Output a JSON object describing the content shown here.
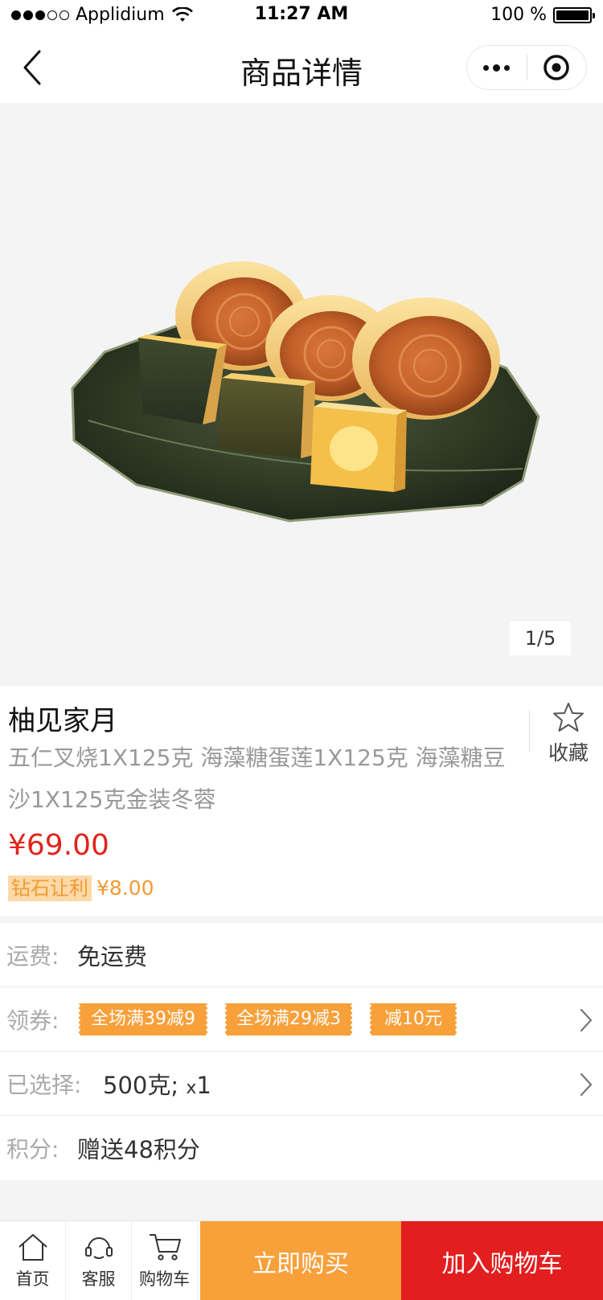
{
  "status_bar": {
    "carrier": "Applidium",
    "time": "11:27 AM",
    "battery": "100 %",
    "signal_bars_filled": 3,
    "signal_bars_total": 5
  },
  "nav": {
    "title": "商品详情",
    "back_icon": "chevron-left-icon",
    "more_icon": "more-dots-icon",
    "close_icon": "target-circle-icon"
  },
  "gallery": {
    "image_subject": "mooncakes on green plate",
    "current_index": "1",
    "total": "5",
    "indicator": "1/5"
  },
  "product": {
    "name": "柚见家月",
    "description": "五仁叉烧1X125克 海藻糖蛋莲1X125克 海藻糖豆沙1X125克金装冬蓉",
    "favorite_label": "收藏",
    "favorite_icon": "star-outline-icon",
    "price": "¥69.00",
    "member_tag": "钻石让利",
    "member_price": "¥8.00"
  },
  "details": {
    "shipping": {
      "label": "运费:",
      "value": "免运费"
    },
    "coupons": {
      "label": "领券:",
      "items": [
        "全场满39减9",
        "全场满29减3",
        "减10元"
      ]
    },
    "selected": {
      "label": "已选择:",
      "value": "500克;",
      "qty_prefix": "x",
      "qty": "1"
    },
    "points": {
      "label": "积分:",
      "value": "赠送48积分"
    }
  },
  "bottom_bar": {
    "home_label": "首页",
    "service_label": "客服",
    "cart_label": "购物车",
    "buy_now_label": "立即购买",
    "add_to_cart_label": "加入购物车"
  },
  "colors": {
    "price_red": "#e0241b",
    "orange": "#f8a03a",
    "cart_red": "#e21e1e"
  }
}
